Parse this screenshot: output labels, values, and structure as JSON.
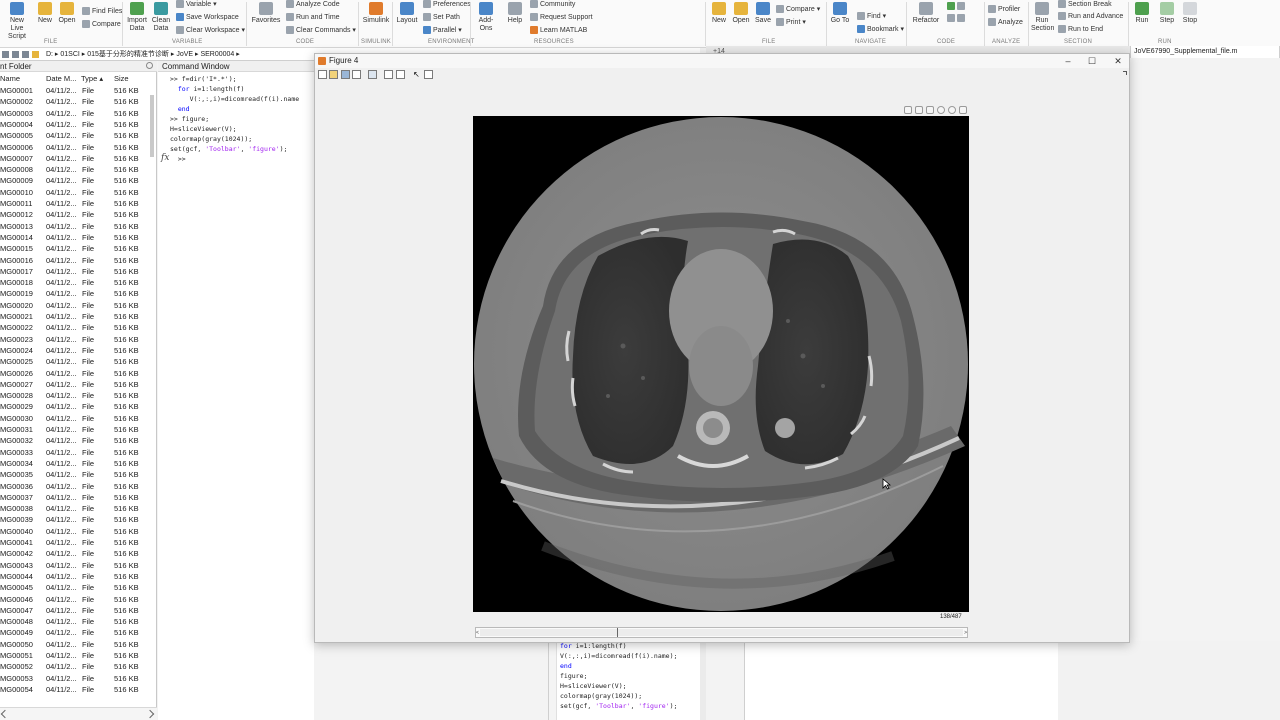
{
  "ribbon": {
    "file": {
      "new_script": "New\nLive Script",
      "new": "New",
      "open": "Open",
      "find_files": "Find Files",
      "compare": "Compare",
      "section": "FILE"
    },
    "variable": {
      "import": "Import\nData",
      "clean": "Clean\nData",
      "variable": "Variable",
      "save_ws": "Save Workspace",
      "clear_ws": "Clear Workspace",
      "section": "VARIABLE"
    },
    "code": {
      "favorites": "Favorites",
      "analyze": "Analyze Code",
      "run_time": "Run and Time",
      "clear_cmds": "Clear Commands",
      "section": "CODE"
    },
    "simulink": {
      "label": "Simulink",
      "section": "SIMULINK"
    },
    "environment": {
      "layout": "Layout",
      "preferences": "Preferences",
      "set_path": "Set Path",
      "parallel": "Parallel",
      "section": "ENVIRONMENT"
    },
    "resources": {
      "addons": "Add-Ons",
      "help": "Help",
      "community": "Community",
      "request": "Request Support",
      "learn": "Learn MATLAB",
      "section": "RESOURCES"
    },
    "editor_file": {
      "new": "New",
      "open": "Open",
      "save": "Save",
      "compare": "Compare",
      "print": "Print",
      "section": "FILE"
    },
    "navigate": {
      "goto": "Go To",
      "find": "Find",
      "bookmark": "Bookmark",
      "section": "NAVIGATE"
    },
    "editor_code": {
      "refactor": "Refactor",
      "section": "CODE"
    },
    "analyze": {
      "profiler": "Profiler",
      "analyze": "Analyze",
      "section": "ANALYZE"
    },
    "section_group": {
      "run_section": "Run\nSection",
      "section_break": "Section Break",
      "run_advance": "Run and Advance",
      "run_end": "Run to End",
      "section": "SECTION"
    },
    "run": {
      "run": "Run",
      "step": "Step",
      "stop": "Stop",
      "section": "RUN"
    }
  },
  "address": {
    "path": [
      "D:",
      "01SCI",
      "015基于分形的精准节诊断",
      "JoVE",
      "SER00004"
    ]
  },
  "folder": {
    "title": "nt Folder",
    "columns": {
      "name": "Name",
      "date": "Date M...",
      "type": "Type",
      "size": "Size"
    },
    "type_sort": "▴",
    "rows": [
      {
        "name": "MG00001",
        "date": "04/11/2...",
        "type": "File",
        "size": "516 KB"
      },
      {
        "name": "MG00002",
        "date": "04/11/2...",
        "type": "File",
        "size": "516 KB"
      },
      {
        "name": "MG00003",
        "date": "04/11/2...",
        "type": "File",
        "size": "516 KB"
      },
      {
        "name": "MG00004",
        "date": "04/11/2...",
        "type": "File",
        "size": "516 KB"
      },
      {
        "name": "MG00005",
        "date": "04/11/2...",
        "type": "File",
        "size": "516 KB"
      },
      {
        "name": "MG00006",
        "date": "04/11/2...",
        "type": "File",
        "size": "516 KB"
      },
      {
        "name": "MG00007",
        "date": "04/11/2...",
        "type": "File",
        "size": "516 KB"
      },
      {
        "name": "MG00008",
        "date": "04/11/2...",
        "type": "File",
        "size": "516 KB"
      },
      {
        "name": "MG00009",
        "date": "04/11/2...",
        "type": "File",
        "size": "516 KB"
      },
      {
        "name": "MG00010",
        "date": "04/11/2...",
        "type": "File",
        "size": "516 KB"
      },
      {
        "name": "MG00011",
        "date": "04/11/2...",
        "type": "File",
        "size": "516 KB"
      },
      {
        "name": "MG00012",
        "date": "04/11/2...",
        "type": "File",
        "size": "516 KB"
      },
      {
        "name": "MG00013",
        "date": "04/11/2...",
        "type": "File",
        "size": "516 KB"
      },
      {
        "name": "MG00014",
        "date": "04/11/2...",
        "type": "File",
        "size": "516 KB"
      },
      {
        "name": "MG00015",
        "date": "04/11/2...",
        "type": "File",
        "size": "516 KB"
      },
      {
        "name": "MG00016",
        "date": "04/11/2...",
        "type": "File",
        "size": "516 KB"
      },
      {
        "name": "MG00017",
        "date": "04/11/2...",
        "type": "File",
        "size": "516 KB"
      },
      {
        "name": "MG00018",
        "date": "04/11/2...",
        "type": "File",
        "size": "516 KB"
      },
      {
        "name": "MG00019",
        "date": "04/11/2...",
        "type": "File",
        "size": "516 KB"
      },
      {
        "name": "MG00020",
        "date": "04/11/2...",
        "type": "File",
        "size": "516 KB"
      },
      {
        "name": "MG00021",
        "date": "04/11/2...",
        "type": "File",
        "size": "516 KB"
      },
      {
        "name": "MG00022",
        "date": "04/11/2...",
        "type": "File",
        "size": "516 KB"
      },
      {
        "name": "MG00023",
        "date": "04/11/2...",
        "type": "File",
        "size": "516 KB"
      },
      {
        "name": "MG00024",
        "date": "04/11/2...",
        "type": "File",
        "size": "516 KB"
      },
      {
        "name": "MG00025",
        "date": "04/11/2...",
        "type": "File",
        "size": "516 KB"
      },
      {
        "name": "MG00026",
        "date": "04/11/2...",
        "type": "File",
        "size": "516 KB"
      },
      {
        "name": "MG00027",
        "date": "04/11/2...",
        "type": "File",
        "size": "516 KB"
      },
      {
        "name": "MG00028",
        "date": "04/11/2...",
        "type": "File",
        "size": "516 KB"
      },
      {
        "name": "MG00029",
        "date": "04/11/2...",
        "type": "File",
        "size": "516 KB"
      },
      {
        "name": "MG00030",
        "date": "04/11/2...",
        "type": "File",
        "size": "516 KB"
      },
      {
        "name": "MG00031",
        "date": "04/11/2...",
        "type": "File",
        "size": "516 KB"
      },
      {
        "name": "MG00032",
        "date": "04/11/2...",
        "type": "File",
        "size": "516 KB"
      },
      {
        "name": "MG00033",
        "date": "04/11/2...",
        "type": "File",
        "size": "516 KB"
      },
      {
        "name": "MG00034",
        "date": "04/11/2...",
        "type": "File",
        "size": "516 KB"
      },
      {
        "name": "MG00035",
        "date": "04/11/2...",
        "type": "File",
        "size": "516 KB"
      },
      {
        "name": "MG00036",
        "date": "04/11/2...",
        "type": "File",
        "size": "516 KB"
      },
      {
        "name": "MG00037",
        "date": "04/11/2...",
        "type": "File",
        "size": "516 KB"
      },
      {
        "name": "MG00038",
        "date": "04/11/2...",
        "type": "File",
        "size": "516 KB"
      },
      {
        "name": "MG00039",
        "date": "04/11/2...",
        "type": "File",
        "size": "516 KB"
      },
      {
        "name": "MG00040",
        "date": "04/11/2...",
        "type": "File",
        "size": "516 KB"
      },
      {
        "name": "MG00041",
        "date": "04/11/2...",
        "type": "File",
        "size": "516 KB"
      },
      {
        "name": "MG00042",
        "date": "04/11/2...",
        "type": "File",
        "size": "516 KB"
      },
      {
        "name": "MG00043",
        "date": "04/11/2...",
        "type": "File",
        "size": "516 KB"
      },
      {
        "name": "MG00044",
        "date": "04/11/2...",
        "type": "File",
        "size": "516 KB"
      },
      {
        "name": "MG00045",
        "date": "04/11/2...",
        "type": "File",
        "size": "516 KB"
      },
      {
        "name": "MG00046",
        "date": "04/11/2...",
        "type": "File",
        "size": "516 KB"
      },
      {
        "name": "MG00047",
        "date": "04/11/2...",
        "type": "File",
        "size": "516 KB"
      },
      {
        "name": "MG00048",
        "date": "04/11/2...",
        "type": "File",
        "size": "516 KB"
      },
      {
        "name": "MG00049",
        "date": "04/11/2...",
        "type": "File",
        "size": "516 KB"
      },
      {
        "name": "MG00050",
        "date": "04/11/2...",
        "type": "File",
        "size": "516 KB"
      },
      {
        "name": "MG00051",
        "date": "04/11/2...",
        "type": "File",
        "size": "516 KB"
      },
      {
        "name": "MG00052",
        "date": "04/11/2...",
        "type": "File",
        "size": "516 KB"
      },
      {
        "name": "MG00053",
        "date": "04/11/2...",
        "type": "File",
        "size": "516 KB"
      },
      {
        "name": "MG00054",
        "date": "04/11/2...",
        "type": "File",
        "size": "516 KB"
      }
    ]
  },
  "command_window": {
    "title": "Command Window",
    "prompt": ">>",
    "fx": "fx"
  },
  "editor_tabs": [
    {
      "label": "+14"
    },
    {
      "label": "JoVE67990_Supplemental_file.m"
    }
  ],
  "editor_bottom": {
    "lines": [
      "for i=1:length(f)",
      "V(:,:,i)=dicomread(f(i).name);",
      "end",
      "figure;",
      "H=sliceViewer(V);",
      "colormap(gray(1024));",
      "set(gcf, 'Toolbar', 'figure');"
    ]
  },
  "figure": {
    "title": "Figure 4",
    "slice_label": "138/487",
    "slice_fraction": 0.283,
    "slider_left": "<",
    "slider_right": ">"
  },
  "icons": [
    "new-icon",
    "open-icon",
    "save-icon",
    "print-icon",
    "zoom-in-icon",
    "zoom-out-icon",
    "pan-icon",
    "home-icon",
    "minimize-icon",
    "maximize-icon",
    "close-icon"
  ]
}
